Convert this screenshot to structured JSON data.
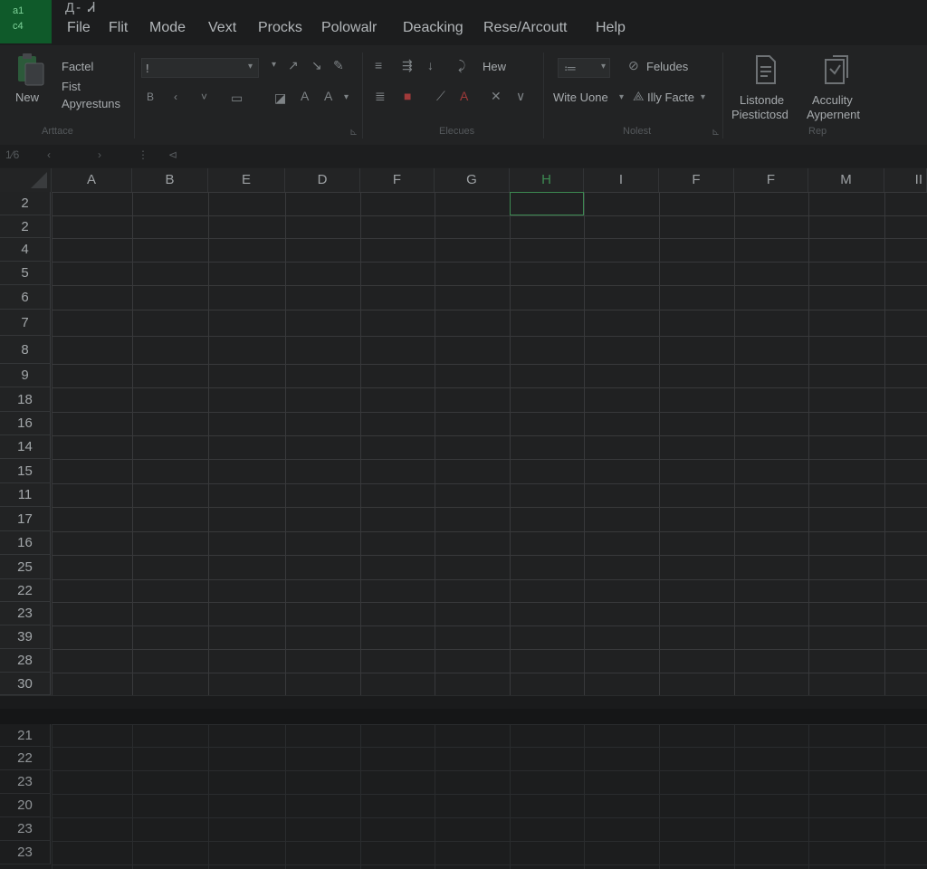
{
  "app_badge": [
    "a1",
    "c4"
  ],
  "quick_access": "Д-  Ꮧ",
  "menu": [
    "File",
    "Flit",
    "Mode",
    "Vext",
    "Procks",
    "Polowalr",
    "Deacking",
    "Rese/Arcoutt",
    "Help"
  ],
  "ribbon": {
    "new_label": "New",
    "clipboard": [
      "Factel",
      "Fist",
      "Apyrestuns"
    ],
    "font_box": "!",
    "group_labels": [
      "Arttace",
      "Elecues",
      "Nolest",
      "Rep"
    ],
    "hew_label": "Hew",
    "feludes_label": "Feludes",
    "wrap_label": "Wite Uone",
    "face_label": "Illy Facte",
    "big_buttons": [
      {
        "line1": "Listonde",
        "line2": "Piestictosd"
      },
      {
        "line1": "Acculity",
        "line2": "Aypernent"
      }
    ]
  },
  "formula_bar": {
    "name_box": "1⁄6"
  },
  "columns": [
    "A",
    "B",
    "E",
    "D",
    "F",
    "G",
    "H",
    "I",
    "F",
    "F",
    "M",
    "II"
  ],
  "rows": [
    "2",
    "2",
    "4",
    "5",
    "6",
    "7",
    "8",
    "9",
    "18",
    "16",
    "14",
    "15",
    "11",
    "17",
    "16",
    "25",
    "22",
    "23",
    "39",
    "28",
    "30"
  ],
  "lower_rows": [
    "21",
    "22",
    "23",
    "20",
    "23",
    "23"
  ],
  "selected_cell": {
    "column": "H",
    "row": "2"
  },
  "colors": {
    "accent": "#0f5a2a",
    "selection": "#3d8a52"
  }
}
